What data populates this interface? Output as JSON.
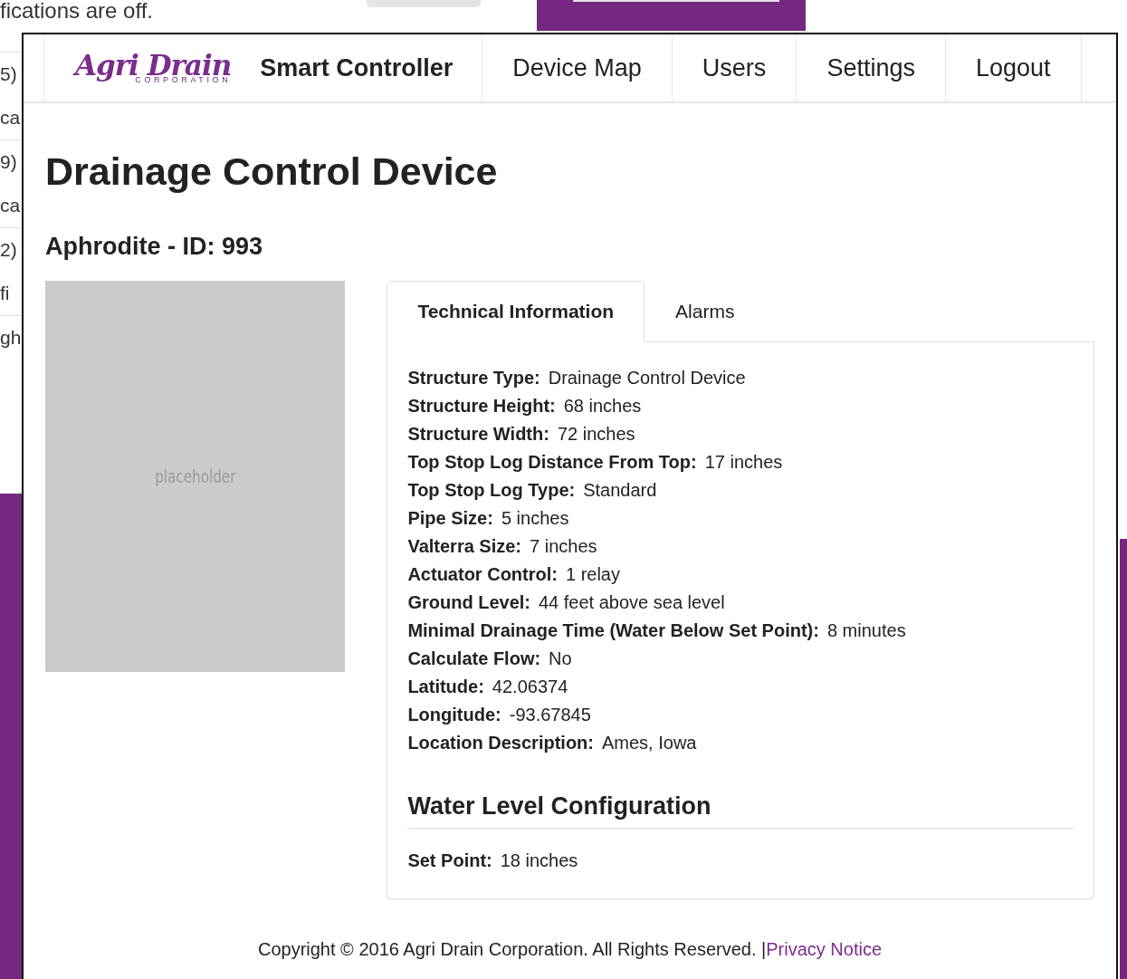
{
  "background_page": {
    "notice": "fications are off.",
    "side_texts": [
      "5)",
      "ca",
      "9)",
      "ca",
      "2)",
      "fi",
      "gh"
    ]
  },
  "navbar": {
    "logo": {
      "name": "Agri Drain",
      "subtitle": "CORPORATION"
    },
    "brand": "Smart Controller",
    "items": [
      "Device Map",
      "Users",
      "Settings",
      "Logout"
    ]
  },
  "title": "Drainage Control Device",
  "subtitle": "Aphrodite - ID: 993",
  "image": {
    "label": "placeholder"
  },
  "tabs": [
    {
      "label": "Technical Information",
      "selected": true
    },
    {
      "label": "Alarms",
      "selected": false
    }
  ],
  "fields": [
    {
      "label": "Structure Type:",
      "value": "Drainage Control Device"
    },
    {
      "label": "Structure Height:",
      "value": "68 inches"
    },
    {
      "label": "Structure Width:",
      "value": "72 inches"
    },
    {
      "label": "Top Stop Log Distance From Top:",
      "value": "17 inches"
    },
    {
      "label": "Top Stop Log Type:",
      "value": "Standard"
    },
    {
      "label": "Pipe Size:",
      "value": "5 inches"
    },
    {
      "label": "Valterra Size:",
      "value": "7 inches"
    },
    {
      "label": "Actuator Control:",
      "value": "1 relay"
    },
    {
      "label": "Ground Level:",
      "value": "44 feet above sea level"
    },
    {
      "label": "Minimal Drainage Time (Water Below Set Point):",
      "value": "8 minutes"
    },
    {
      "label": "Calculate Flow:",
      "value": "No"
    },
    {
      "label": "Latitude:",
      "value": "42.06374"
    },
    {
      "label": "Longitude:",
      "value": "-93.67845"
    },
    {
      "label": "Location Description:",
      "value": "Ames, Iowa"
    }
  ],
  "section": {
    "title": "Water Level Configuration",
    "fields": [
      {
        "label": "Set Point:",
        "value": "18 inches"
      }
    ]
  },
  "footer": {
    "text": "Copyright © 2016 Agri Drain Corporation. All Rights Reserved. |",
    "link": "Privacy Notice"
  }
}
